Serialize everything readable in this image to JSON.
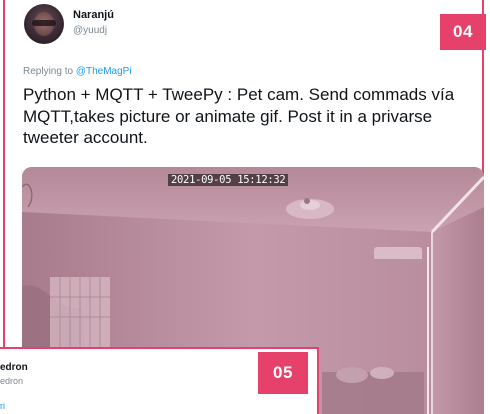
{
  "card_04": {
    "badge": "04",
    "author": {
      "display_name": "Naranjú",
      "handle": "@yuudj",
      "avatar_icon": "user-avatar-icon"
    },
    "reply": {
      "prefix": "Replying to ",
      "mention": "@TheMagPi"
    },
    "text": "Python + MQTT + TweePy : Pet cam. Send commads vía MQTT,takes picture or animate gif. Post it in a privarse tweeter account.",
    "media": {
      "timestamp": "2021-09-05 15:12:32"
    }
  },
  "card_05": {
    "badge": "05",
    "display_name_fragment": "edron",
    "handle_fragment": "edron",
    "mention_fragment": "ri"
  },
  "colors": {
    "accent": "#e5416a",
    "link": "#1d9bf0",
    "muted": "#7a8791",
    "text": "#0f1419"
  }
}
